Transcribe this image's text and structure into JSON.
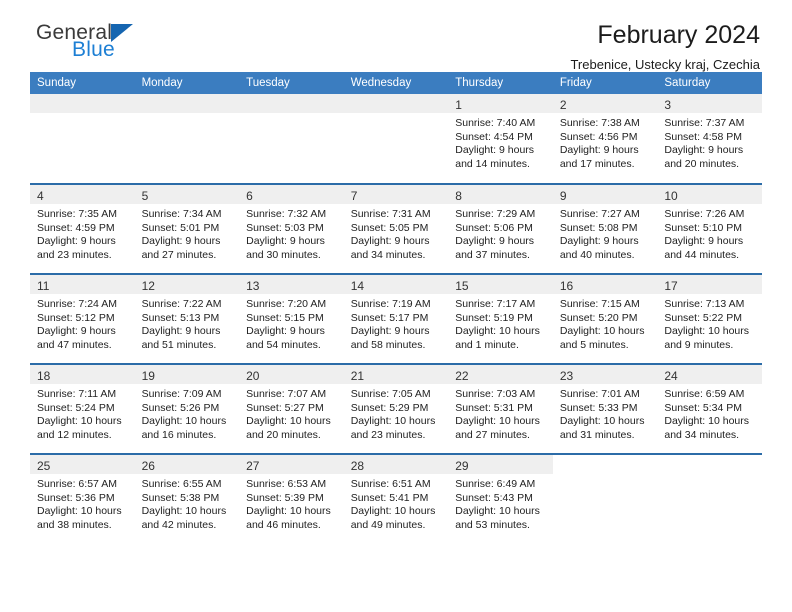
{
  "brand": {
    "name_part1": "General",
    "name_part2": "Blue"
  },
  "header": {
    "title": "February 2024",
    "location": "Trebenice, Ustecky kraj, Czechia"
  },
  "calendar": {
    "day_headers": [
      "Sunday",
      "Monday",
      "Tuesday",
      "Wednesday",
      "Thursday",
      "Friday",
      "Saturday"
    ],
    "accent_color": "#3b7dc0",
    "separator_color": "#2c6ca8",
    "daynum_band_color": "#efefef",
    "weeks": [
      [
        {
          "day": "",
          "lines": []
        },
        {
          "day": "",
          "lines": []
        },
        {
          "day": "",
          "lines": []
        },
        {
          "day": "",
          "lines": []
        },
        {
          "day": "1",
          "lines": [
            "Sunrise: 7:40 AM",
            "Sunset: 4:54 PM",
            "Daylight: 9 hours",
            "and 14 minutes."
          ]
        },
        {
          "day": "2",
          "lines": [
            "Sunrise: 7:38 AM",
            "Sunset: 4:56 PM",
            "Daylight: 9 hours",
            "and 17 minutes."
          ]
        },
        {
          "day": "3",
          "lines": [
            "Sunrise: 7:37 AM",
            "Sunset: 4:58 PM",
            "Daylight: 9 hours",
            "and 20 minutes."
          ]
        }
      ],
      [
        {
          "day": "4",
          "lines": [
            "Sunrise: 7:35 AM",
            "Sunset: 4:59 PM",
            "Daylight: 9 hours",
            "and 23 minutes."
          ]
        },
        {
          "day": "5",
          "lines": [
            "Sunrise: 7:34 AM",
            "Sunset: 5:01 PM",
            "Daylight: 9 hours",
            "and 27 minutes."
          ]
        },
        {
          "day": "6",
          "lines": [
            "Sunrise: 7:32 AM",
            "Sunset: 5:03 PM",
            "Daylight: 9 hours",
            "and 30 minutes."
          ]
        },
        {
          "day": "7",
          "lines": [
            "Sunrise: 7:31 AM",
            "Sunset: 5:05 PM",
            "Daylight: 9 hours",
            "and 34 minutes."
          ]
        },
        {
          "day": "8",
          "lines": [
            "Sunrise: 7:29 AM",
            "Sunset: 5:06 PM",
            "Daylight: 9 hours",
            "and 37 minutes."
          ]
        },
        {
          "day": "9",
          "lines": [
            "Sunrise: 7:27 AM",
            "Sunset: 5:08 PM",
            "Daylight: 9 hours",
            "and 40 minutes."
          ]
        },
        {
          "day": "10",
          "lines": [
            "Sunrise: 7:26 AM",
            "Sunset: 5:10 PM",
            "Daylight: 9 hours",
            "and 44 minutes."
          ]
        }
      ],
      [
        {
          "day": "11",
          "lines": [
            "Sunrise: 7:24 AM",
            "Sunset: 5:12 PM",
            "Daylight: 9 hours",
            "and 47 minutes."
          ]
        },
        {
          "day": "12",
          "lines": [
            "Sunrise: 7:22 AM",
            "Sunset: 5:13 PM",
            "Daylight: 9 hours",
            "and 51 minutes."
          ]
        },
        {
          "day": "13",
          "lines": [
            "Sunrise: 7:20 AM",
            "Sunset: 5:15 PM",
            "Daylight: 9 hours",
            "and 54 minutes."
          ]
        },
        {
          "day": "14",
          "lines": [
            "Sunrise: 7:19 AM",
            "Sunset: 5:17 PM",
            "Daylight: 9 hours",
            "and 58 minutes."
          ]
        },
        {
          "day": "15",
          "lines": [
            "Sunrise: 7:17 AM",
            "Sunset: 5:19 PM",
            "Daylight: 10 hours",
            "and 1 minute."
          ]
        },
        {
          "day": "16",
          "lines": [
            "Sunrise: 7:15 AM",
            "Sunset: 5:20 PM",
            "Daylight: 10 hours",
            "and 5 minutes."
          ]
        },
        {
          "day": "17",
          "lines": [
            "Sunrise: 7:13 AM",
            "Sunset: 5:22 PM",
            "Daylight: 10 hours",
            "and 9 minutes."
          ]
        }
      ],
      [
        {
          "day": "18",
          "lines": [
            "Sunrise: 7:11 AM",
            "Sunset: 5:24 PM",
            "Daylight: 10 hours",
            "and 12 minutes."
          ]
        },
        {
          "day": "19",
          "lines": [
            "Sunrise: 7:09 AM",
            "Sunset: 5:26 PM",
            "Daylight: 10 hours",
            "and 16 minutes."
          ]
        },
        {
          "day": "20",
          "lines": [
            "Sunrise: 7:07 AM",
            "Sunset: 5:27 PM",
            "Daylight: 10 hours",
            "and 20 minutes."
          ]
        },
        {
          "day": "21",
          "lines": [
            "Sunrise: 7:05 AM",
            "Sunset: 5:29 PM",
            "Daylight: 10 hours",
            "and 23 minutes."
          ]
        },
        {
          "day": "22",
          "lines": [
            "Sunrise: 7:03 AM",
            "Sunset: 5:31 PM",
            "Daylight: 10 hours",
            "and 27 minutes."
          ]
        },
        {
          "day": "23",
          "lines": [
            "Sunrise: 7:01 AM",
            "Sunset: 5:33 PM",
            "Daylight: 10 hours",
            "and 31 minutes."
          ]
        },
        {
          "day": "24",
          "lines": [
            "Sunrise: 6:59 AM",
            "Sunset: 5:34 PM",
            "Daylight: 10 hours",
            "and 34 minutes."
          ]
        }
      ],
      [
        {
          "day": "25",
          "lines": [
            "Sunrise: 6:57 AM",
            "Sunset: 5:36 PM",
            "Daylight: 10 hours",
            "and 38 minutes."
          ]
        },
        {
          "day": "26",
          "lines": [
            "Sunrise: 6:55 AM",
            "Sunset: 5:38 PM",
            "Daylight: 10 hours",
            "and 42 minutes."
          ]
        },
        {
          "day": "27",
          "lines": [
            "Sunrise: 6:53 AM",
            "Sunset: 5:39 PM",
            "Daylight: 10 hours",
            "and 46 minutes."
          ]
        },
        {
          "day": "28",
          "lines": [
            "Sunrise: 6:51 AM",
            "Sunset: 5:41 PM",
            "Daylight: 10 hours",
            "and 49 minutes."
          ]
        },
        {
          "day": "29",
          "lines": [
            "Sunrise: 6:49 AM",
            "Sunset: 5:43 PM",
            "Daylight: 10 hours",
            "and 53 minutes."
          ]
        },
        {
          "day": "",
          "lines": []
        },
        {
          "day": "",
          "lines": []
        }
      ]
    ]
  }
}
